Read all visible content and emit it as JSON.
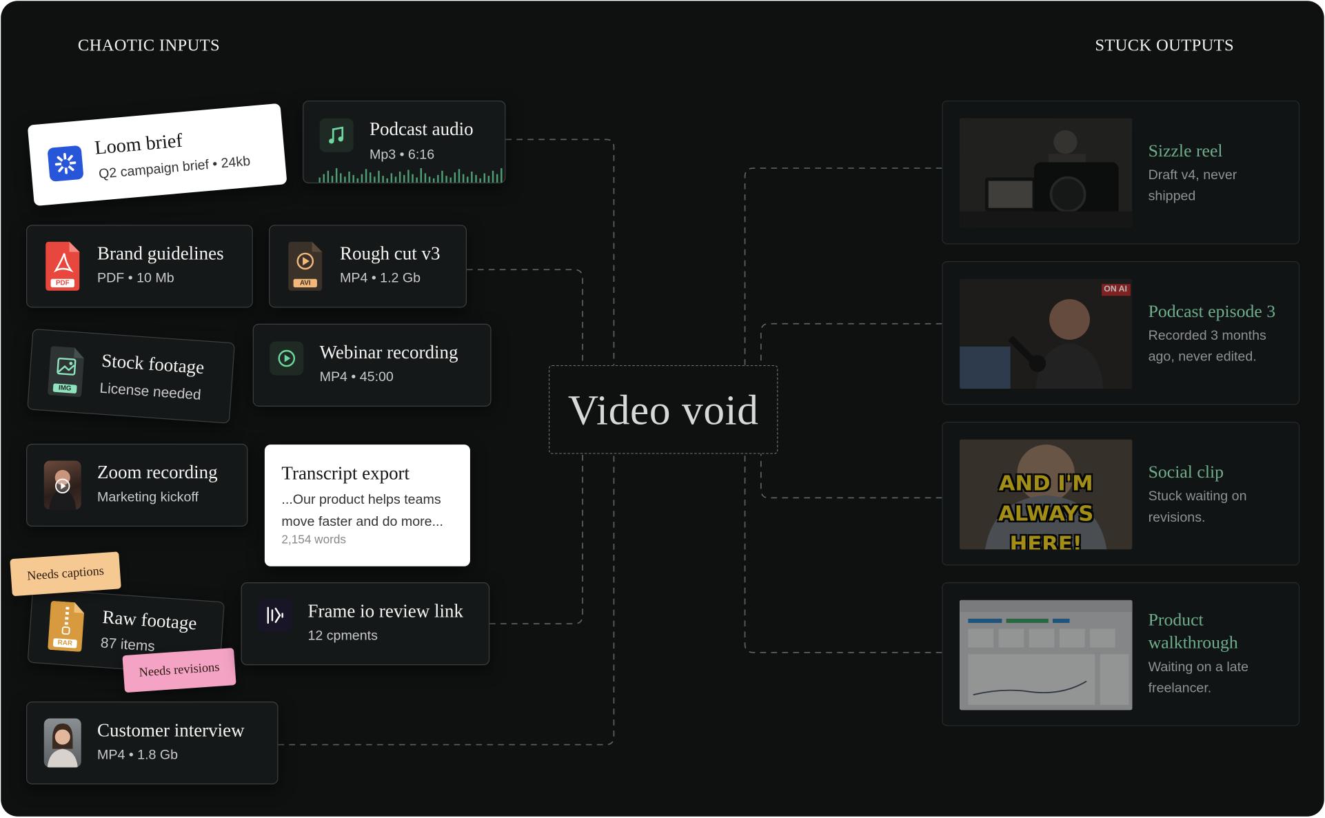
{
  "headings": {
    "inputs": "CHAOTIC INPUTS",
    "outputs": "STUCK OUTPUTS"
  },
  "center": {
    "label": "Video void"
  },
  "inputs": {
    "loom": {
      "title": "Loom brief",
      "subtitle": "Q2 campaign brief  •  24kb"
    },
    "podcast_audio": {
      "title": "Podcast audio",
      "subtitle": "Mp3  •  6:16"
    },
    "brand": {
      "title": "Brand guidelines",
      "subtitle": "PDF  •  10 Mb",
      "badge": "PDF"
    },
    "rough_cut": {
      "title": "Rough cut v3",
      "subtitle": "MP4  •  1.2 Gb",
      "badge": "AVI"
    },
    "stock": {
      "title": "Stock footage",
      "subtitle": "License needed",
      "badge": "IMG"
    },
    "webinar": {
      "title": "Webinar recording",
      "subtitle": "MP4  •  45:00"
    },
    "zoom": {
      "title": "Zoom recording",
      "subtitle": "Marketing kickoff"
    },
    "transcript": {
      "title": "Transcript export",
      "body": "...Our product helps teams move faster and do more...",
      "meta": "2,154 words"
    },
    "raw": {
      "title": "Raw footage",
      "subtitle": "87 items",
      "badge": "RAR"
    },
    "frameio": {
      "title": "Frame io review link",
      "subtitle": "12 cpments"
    },
    "interview": {
      "title": "Customer interview",
      "subtitle": "MP4  •  1.8 Gb"
    }
  },
  "tags": {
    "captions": "Needs captions",
    "revisions": "Needs revisions"
  },
  "outputs": [
    {
      "title": "Sizzle reel",
      "desc": "Draft v4, never shipped"
    },
    {
      "title": "Podcast episode 3",
      "desc": "Recorded 3 months ago, never edited.",
      "thumb_text": "ON AI"
    },
    {
      "title": "Social clip",
      "desc": "Stuck waiting on revisions.",
      "thumb_lines": [
        "AND I'M",
        "ALWAYS HERE!"
      ]
    },
    {
      "title": "Product walkthrough",
      "desc": "Waiting on a late freelancer."
    }
  ],
  "colors": {
    "accent": "#6fae8c",
    "background": "#0f1111",
    "tag_orange": "#f7c992",
    "tag_pink": "#f4a3c4"
  }
}
